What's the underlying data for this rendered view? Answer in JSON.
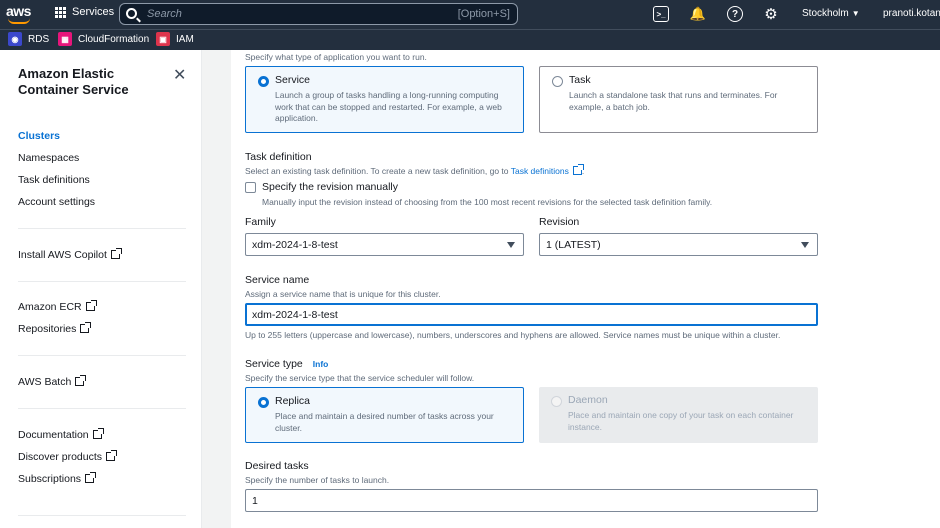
{
  "topnav": {
    "logo": "aws",
    "services_label": "Services",
    "search_placeholder": "Search",
    "search_shortcut": "[Option+S]",
    "region": "Stockholm",
    "user": "pranoti.kotang"
  },
  "favorites": [
    {
      "label": "RDS",
      "color": "#3b48cc",
      "icon": "rds-icon"
    },
    {
      "label": "CloudFormation",
      "color": "#e7157b",
      "icon": "cloudformation-icon"
    },
    {
      "label": "IAM",
      "color": "#dd344c",
      "icon": "iam-icon"
    }
  ],
  "sidebar": {
    "title": "Amazon Elastic Container Service",
    "items": [
      {
        "label": "Clusters",
        "active": true
      },
      {
        "label": "Namespaces"
      },
      {
        "label": "Task definitions"
      },
      {
        "label": "Account settings"
      },
      {
        "label": "Install AWS Copilot",
        "external": true
      },
      {
        "label": "Amazon ECR",
        "external": true
      },
      {
        "label": "Repositories",
        "external": true
      },
      {
        "label": "AWS Batch",
        "external": true
      },
      {
        "label": "Documentation",
        "external": true
      },
      {
        "label": "Discover products",
        "external": true
      },
      {
        "label": "Subscriptions",
        "external": true
      }
    ]
  },
  "form": {
    "app_type_hint": "Specify what type of application you want to run.",
    "app_types": [
      {
        "title": "Service",
        "desc": "Launch a group of tasks handling a long-running computing work that can be stopped and restarted. For example, a web application.",
        "selected": true
      },
      {
        "title": "Task",
        "desc": "Launch a standalone task that runs and terminates. For example, a batch job.",
        "selected": false
      }
    ],
    "task_def_label": "Task definition",
    "task_def_hint": "Select an existing task definition. To create a new task definition, go to",
    "task_def_link": "Task definitions",
    "task_def_hint_end": ".",
    "revision_manual_label": "Specify the revision manually",
    "revision_manual_hint": "Manually input the revision instead of choosing from the 100 most recent revisions for the selected task definition family.",
    "family_label": "Family",
    "family_value": "xdm-2024-1-8-test",
    "revision_label": "Revision",
    "revision_value": "1 (LATEST)",
    "service_name_label": "Service name",
    "service_name_hint": "Assign a service name that is unique for this cluster.",
    "service_name_value": "xdm-2024-1-8-test",
    "service_name_constraint": "Up to 255 letters (uppercase and lowercase), numbers, underscores and hyphens are allowed. Service names must be unique within a cluster.",
    "service_type_label": "Service type",
    "service_type_info": "Info",
    "service_type_hint": "Specify the service type that the service scheduler will follow.",
    "service_types": [
      {
        "title": "Replica",
        "desc": "Place and maintain a desired number of tasks across your cluster.",
        "selected": true,
        "disabled": false
      },
      {
        "title": "Daemon",
        "desc": "Place and maintain one copy of your task on each container instance.",
        "selected": false,
        "disabled": true
      }
    ],
    "desired_tasks_label": "Desired tasks",
    "desired_tasks_hint": "Specify the number of tasks to launch.",
    "desired_tasks_value": "1"
  }
}
